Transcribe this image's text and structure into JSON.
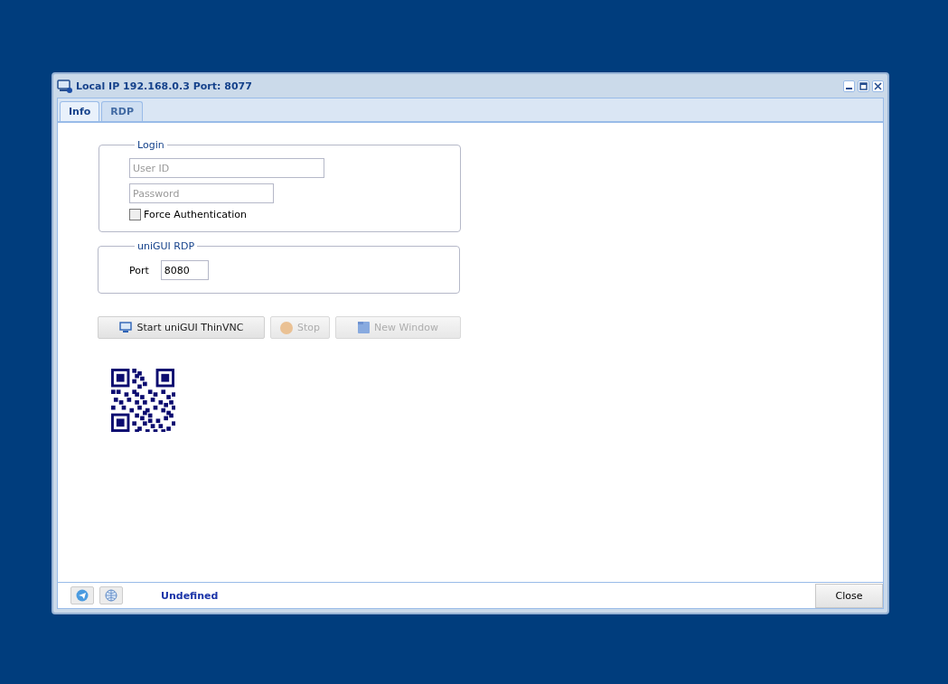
{
  "window": {
    "title": "Local IP 192.168.0.3 Port: 8077"
  },
  "tabs": [
    {
      "label": "Info",
      "selected": true
    },
    {
      "label": "RDP",
      "selected": false
    }
  ],
  "login": {
    "legend": "Login",
    "user_id": {
      "placeholder": "User ID"
    },
    "password": {
      "placeholder": "Password"
    },
    "force_auth": {
      "label": "Force Authentication",
      "checked": false
    }
  },
  "rdp": {
    "legend": "uniGUI RDP",
    "port_label": "Port",
    "port_value": "8080"
  },
  "buttons": [
    {
      "kind": "monitor",
      "label": "Start uniGUI ThinVNC",
      "disabled": false
    },
    {
      "kind": "stop",
      "label": "Stop",
      "disabled": true
    },
    {
      "kind": "window",
      "label": "New Window",
      "disabled": true
    }
  ],
  "status_bar": {
    "text": "Undefined",
    "close": "Close"
  }
}
